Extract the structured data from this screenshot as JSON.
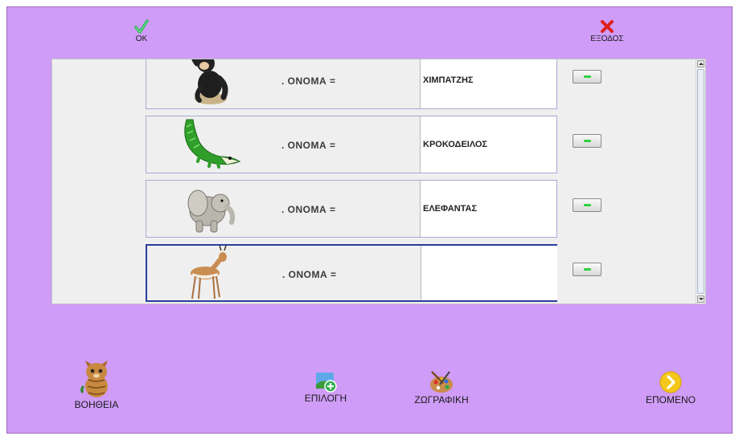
{
  "toolbar": {
    "ok_label": "OK",
    "exit_label": "ΕΞΟΔΟΣ"
  },
  "form": {
    "field_label": ". ΟΝΟΜΑ =",
    "rows": [
      {
        "animal": "chimpanzee",
        "answer": "ΧΙΜΠΑΤΖΗΣ"
      },
      {
        "animal": "crocodile",
        "answer": "ΚΡΟΚΟΔΕΙΛΟΣ"
      },
      {
        "animal": "elephant",
        "answer": "ΕΛΕΦΑΝΤΑΣ"
      },
      {
        "animal": "gazelle",
        "answer": ""
      }
    ]
  },
  "bottom": {
    "help_label": "ΒΟΗΘΕΙΑ",
    "select_label": "ΕΠΙΛΟΓΗ",
    "paint_label": "ΖΩΓΡΑΦΙΚΗ",
    "next_label": "ΕΠΟΜΕΝΟ"
  },
  "colors": {
    "background": "#cf9cf7",
    "panel": "#efefef",
    "active_border": "#2a3c9c",
    "ok_check": "#1bb24b",
    "exit_x": "#e0201e",
    "next_circle": "#f4c81a"
  },
  "icons": {
    "ok": "check-icon",
    "exit": "close-icon",
    "help": "cat-icon",
    "select": "add-image-icon",
    "paint": "palette-icon",
    "next": "arrow-right-icon"
  }
}
